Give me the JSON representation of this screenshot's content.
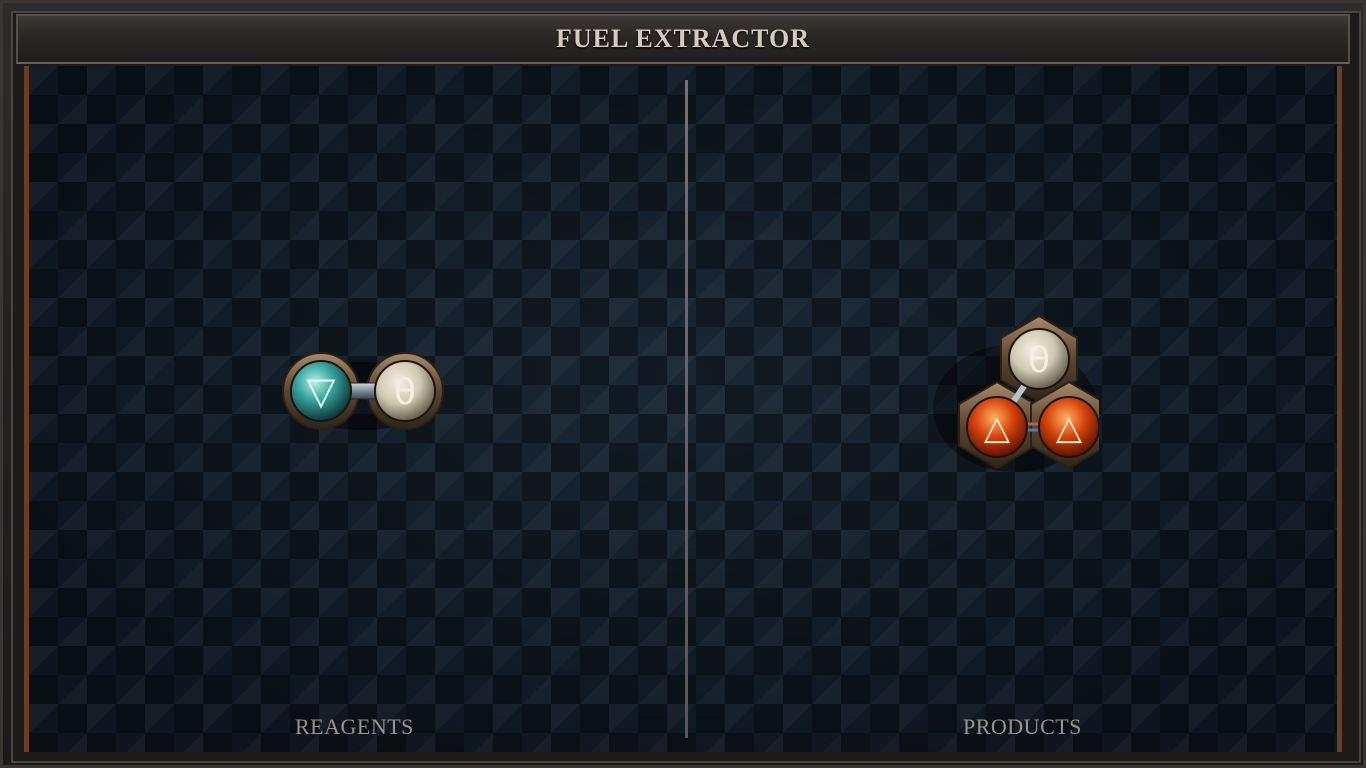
{
  "title": "FUEL EXTRACTOR",
  "panels": {
    "reagents": {
      "label": "REAGENTS",
      "atoms": [
        {
          "symbol": "▽",
          "element": "water",
          "color": "#3aa8a0"
        },
        {
          "symbol": "θ",
          "element": "salt",
          "color": "#d8d2c0"
        }
      ]
    },
    "products": {
      "label": "PRODUCTS",
      "atoms": [
        {
          "symbol": "θ",
          "element": "salt",
          "color": "#d8d2c0"
        },
        {
          "symbol": "△",
          "element": "fire",
          "color": "#d4420c"
        },
        {
          "symbol": "△",
          "element": "fire",
          "color": "#d4420c"
        }
      ]
    }
  },
  "colors": {
    "frame_accent": "#6b3e22",
    "title_text": "#d4cbbd",
    "label_text": "#9a938a"
  }
}
